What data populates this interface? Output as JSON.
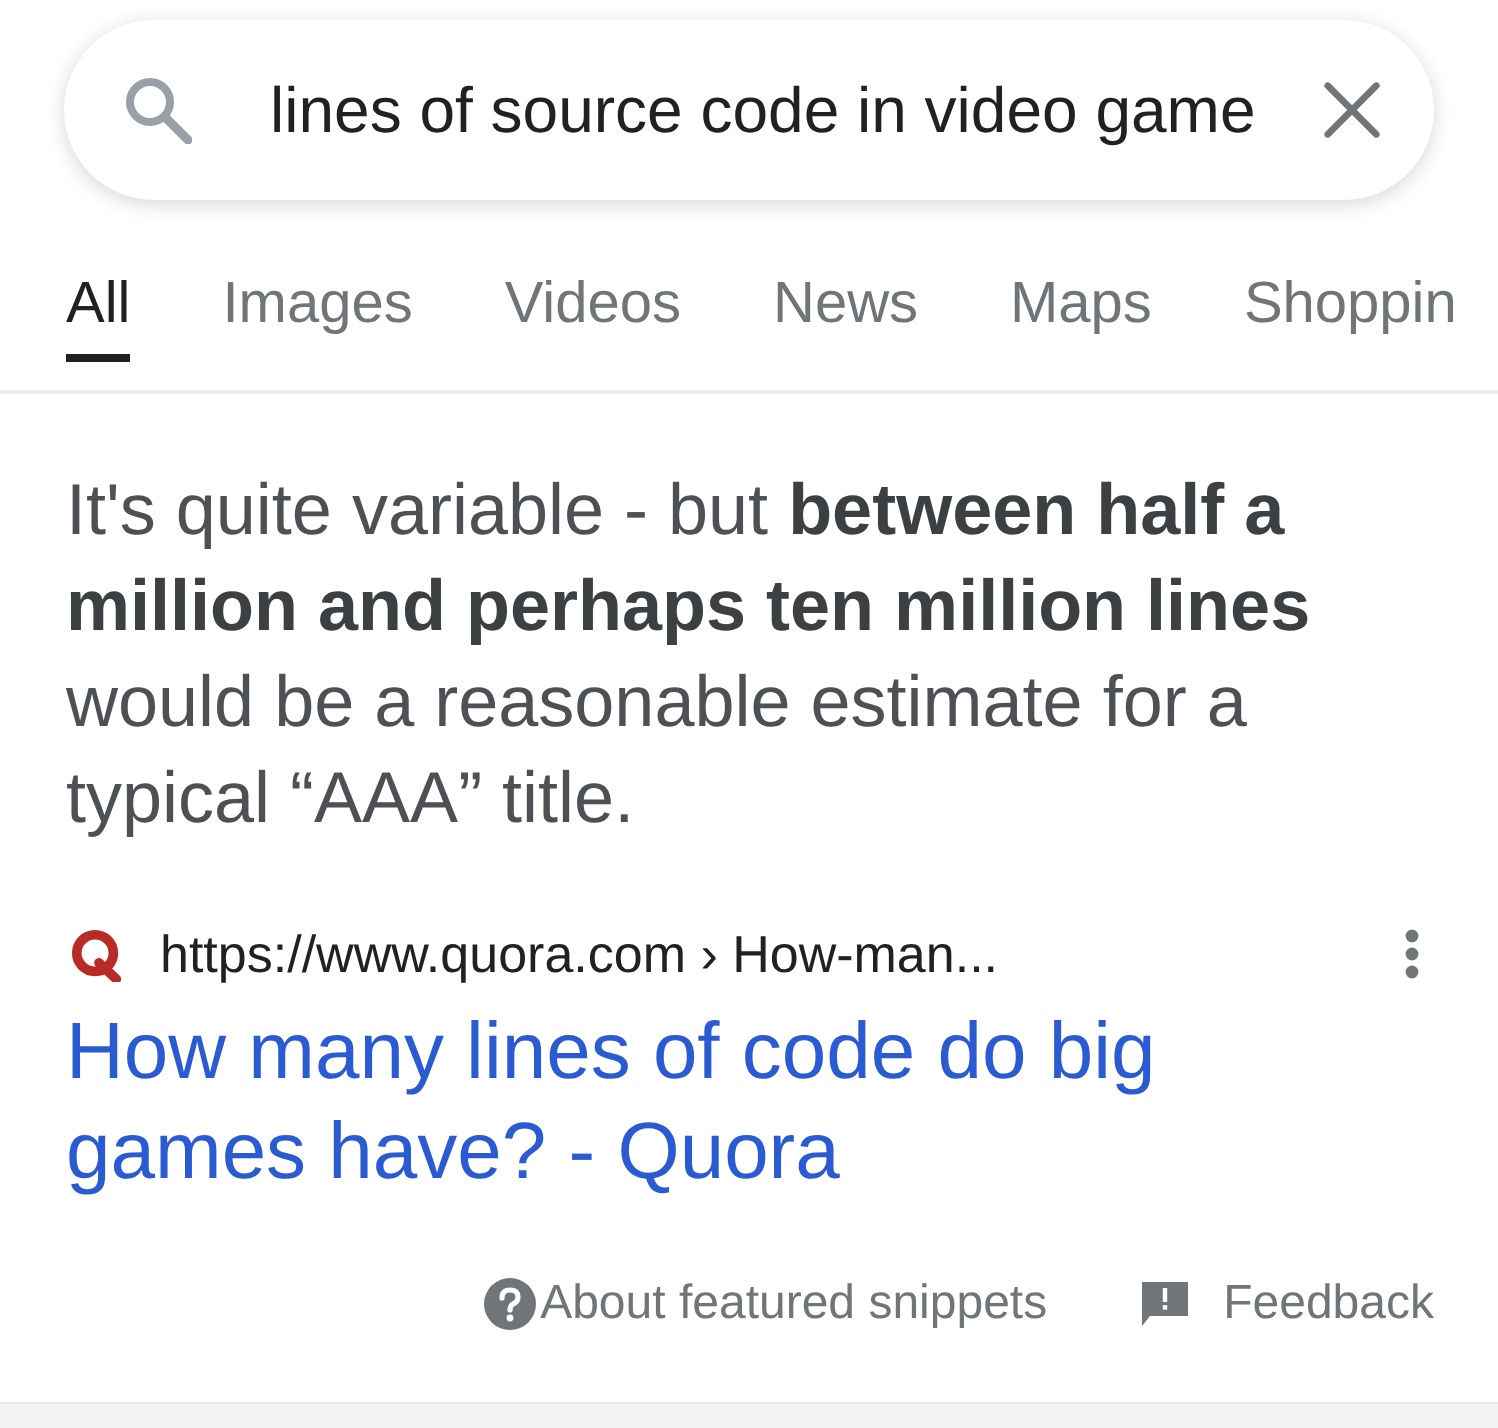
{
  "search": {
    "value": "lines of source code in video game"
  },
  "tabs": [
    {
      "label": "All",
      "selected": true
    },
    {
      "label": "Images",
      "selected": false
    },
    {
      "label": "Videos",
      "selected": false
    },
    {
      "label": "News",
      "selected": false
    },
    {
      "label": "Maps",
      "selected": false
    },
    {
      "label": "Shoppin",
      "selected": false
    }
  ],
  "snippet": {
    "text": "It's quite variable - but **between half a million and perhaps ten million lines** would be a reasonable estimate for a typical “AAA” title.",
    "source": "https://www.quora.com › How-man...",
    "title": "How many lines of code do big games have? - Quora"
  },
  "footer": [
    {
      "kind": "about",
      "label": "About featured snippets"
    },
    {
      "kind": "feedback",
      "label": "Feedback"
    }
  ]
}
